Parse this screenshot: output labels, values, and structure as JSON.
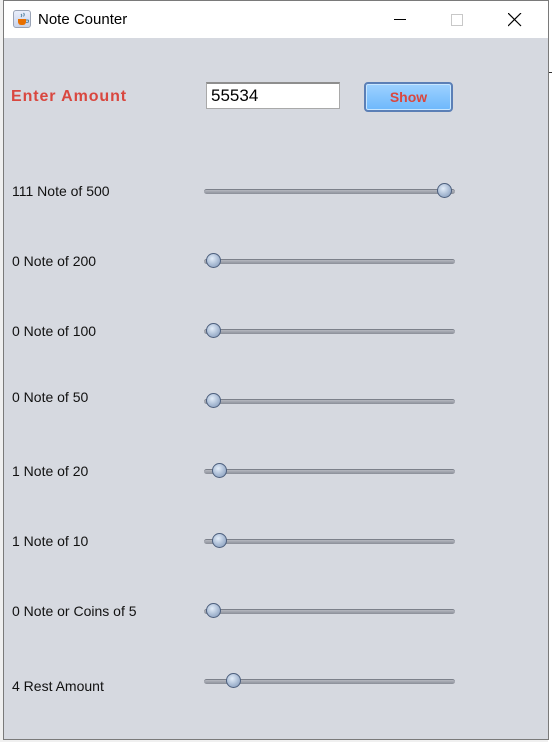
{
  "window": {
    "title": "Note Counter",
    "icon": "java-cup-icon"
  },
  "form": {
    "enter_label": "Enter Amount",
    "amount_value": "55534",
    "show_label": "Show"
  },
  "rows": [
    {
      "label": "111 Note of 500",
      "slider_fraction": 1.0
    },
    {
      "label": "0 Note of 200",
      "slider_fraction": 0.0
    },
    {
      "label": "0 Note of 100",
      "slider_fraction": 0.0
    },
    {
      "label": "0 Note of 50",
      "slider_fraction": 0.0
    },
    {
      "label": "1 Note of 20",
      "slider_fraction": 0.025
    },
    {
      "label": "1 Note of 10",
      "slider_fraction": 0.025
    },
    {
      "label": "0 Note or Coins of 5",
      "slider_fraction": 0.0
    },
    {
      "label": "4 Rest Amount",
      "slider_fraction": 0.085
    }
  ],
  "colors": {
    "label_accent": "#d9473f",
    "button_fill": "#79bdf9",
    "panel_bg": "#d6d9e0"
  }
}
